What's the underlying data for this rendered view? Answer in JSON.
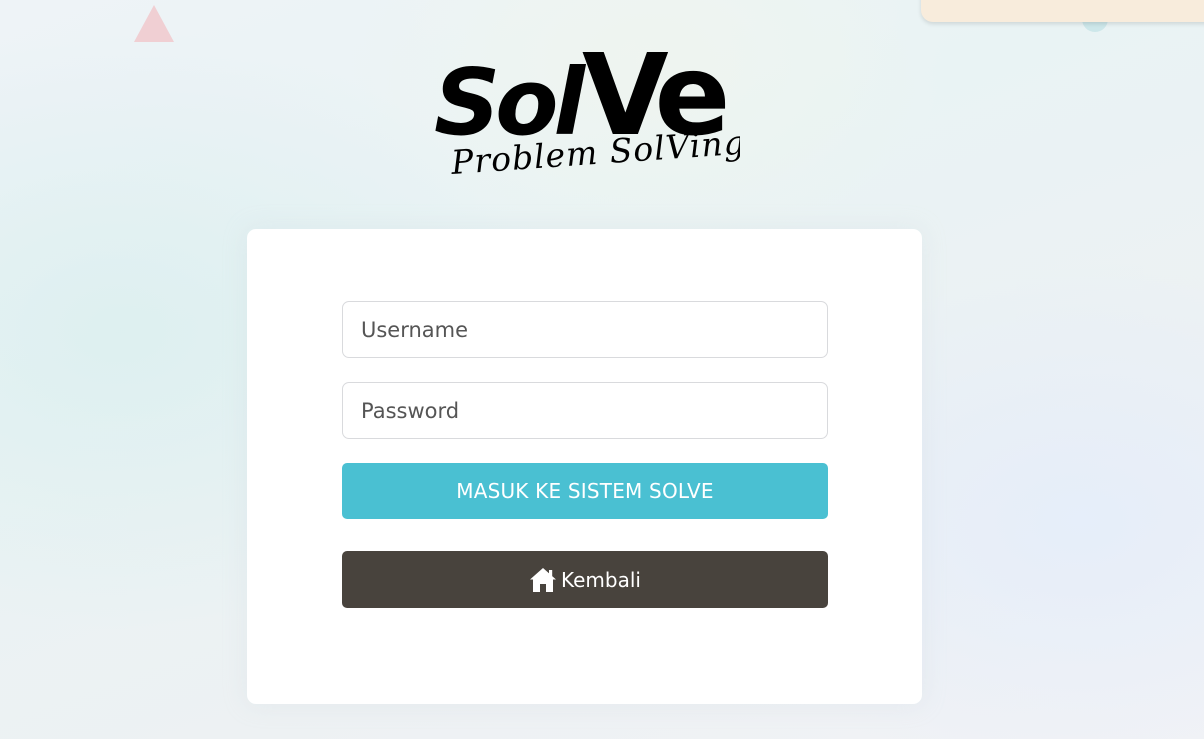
{
  "logo": {
    "brand": "SolVe",
    "brand_part1": "Sol",
    "brand_part2": "Ve",
    "tagline": "Problem SolVing"
  },
  "login_form": {
    "username_placeholder": "Username",
    "password_placeholder": "Password",
    "submit_label": "MASUK KE SISTEM SOLVE",
    "back_label": "Kembali",
    "back_icon": "home-icon"
  },
  "colors": {
    "submit_button": "#4ac0d2",
    "back_button": "#48433d",
    "card_background": "#ffffff",
    "triangle_decoration": "#f0cfd3",
    "top_decoration": "#f8ecdc"
  }
}
